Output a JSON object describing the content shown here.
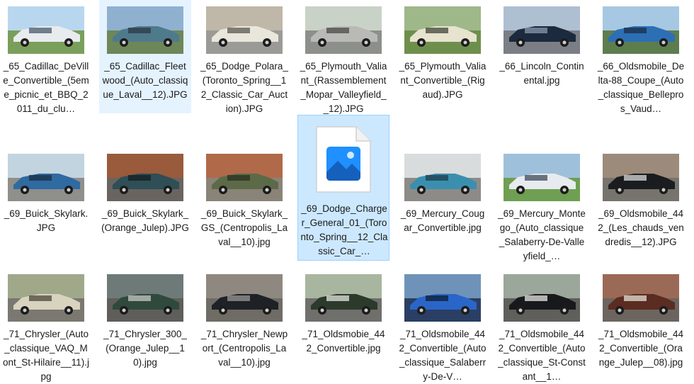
{
  "files": [
    {
      "name": "_65_Cadillac_DeVille_Convertible_(5eme_picnic_et_BBQ_2011_du_clu…",
      "icon": "photo-thumbnail",
      "state": "",
      "colors": {
        "sky": "#b9d6ef",
        "ground": "#7a9f5a",
        "body": "#e8ecef",
        "accent": "#4a5a6a"
      }
    },
    {
      "name": "_65_Cadillac_Fleetwood_(Auto_classique_Laval__12).JPG",
      "icon": "photo-thumbnail",
      "state": "hl",
      "colors": {
        "sky": "#8fb1cf",
        "ground": "#6d8759",
        "body": "#4f7a8c",
        "accent": "#2a3a44"
      }
    },
    {
      "name": "_65_Dodge_Polara_(Toronto_Spring__12_Classic_Car_Auction).JPG",
      "icon": "photo-thumbnail",
      "state": "",
      "colors": {
        "sky": "#bfb7a7",
        "ground": "#9a9a96",
        "body": "#e9e6dc",
        "accent": "#5a5750"
      }
    },
    {
      "name": "_65_Plymouth_Valiant_(Rassemblement_Mopar_Valleyfield__12).JPG",
      "icon": "photo-thumbnail",
      "state": "",
      "colors": {
        "sky": "#c9d2c7",
        "ground": "#8d8f8a",
        "body": "#b9b9b5",
        "accent": "#4a4a48"
      }
    },
    {
      "name": "_65_Plymouth_Valiant_Convertible_(Rigaud).JPG",
      "icon": "photo-thumbnail",
      "state": "",
      "colors": {
        "sky": "#9eb88a",
        "ground": "#6e8f4c",
        "body": "#e7e3cf",
        "accent": "#3e4635"
      }
    },
    {
      "name": "_66_Lincoln_Continental.jpg",
      "icon": "photo-thumbnail",
      "state": "",
      "colors": {
        "sky": "#aebfd2",
        "ground": "#7b7e85",
        "body": "#1c2a3e",
        "accent": "#8b9ab0"
      }
    },
    {
      "name": "_66_Oldsmobile_Delta-88_Coupe_(Auto_classique_Bellepros_Vaud…",
      "icon": "photo-thumbnail",
      "state": "",
      "colors": {
        "sky": "#a7c8e2",
        "ground": "#5e7d4f",
        "body": "#2c6fb5",
        "accent": "#1b2c44"
      }
    },
    {
      "name": "_69_Buick_Skylark.JPG",
      "icon": "photo-thumbnail",
      "state": "",
      "colors": {
        "sky": "#c2d4df",
        "ground": "#8f8f8c",
        "body": "#2f6aa0",
        "accent": "#1a2f44"
      }
    },
    {
      "name": "_69_Buick_Skylark_(Orange_Julep).JPG",
      "icon": "photo-thumbnail",
      "state": "",
      "colors": {
        "sky": "#9a5a3c",
        "ground": "#6a6460",
        "body": "#2f4e56",
        "accent": "#141e22"
      }
    },
    {
      "name": "_69_Buick_Skylark_GS_(Centropolis_Laval__10).jpg",
      "icon": "photo-thumbnail",
      "state": "",
      "colors": {
        "sky": "#b06a4a",
        "ground": "#8a8378",
        "body": "#5c6a48",
        "accent": "#27301e"
      }
    },
    {
      "name": "_69_Dodge_Charger_General_01_(Toronto_Spring__12_Classic_Car_…",
      "icon": "image-file-icon",
      "state": "sel",
      "colors": {
        "sky": "#5fb2f0",
        "ground": "#2a6fc2",
        "body": "#ffffff",
        "accent": "#d9d9d9"
      }
    },
    {
      "name": "_69_Mercury_Cougar_Convertible.jpg",
      "icon": "photo-thumbnail",
      "state": "",
      "colors": {
        "sky": "#d9dcdc",
        "ground": "#8d8b88",
        "body": "#3b8fae",
        "accent": "#1e3d4c"
      }
    },
    {
      "name": "_69_Mercury_Montego_(Auto_classique_Salaberry-De-Valleyfield_…",
      "icon": "photo-thumbnail",
      "state": "",
      "colors": {
        "sky": "#9fc0da",
        "ground": "#6f9f52",
        "body": "#e7ebef",
        "accent": "#3e4a5a"
      }
    },
    {
      "name": "_69_Oldsmobile_442_(Les_chauds_vendredis__12).JPG",
      "icon": "photo-thumbnail",
      "state": "",
      "colors": {
        "sky": "#9c8a7a",
        "ground": "#77746e",
        "body": "#1a1c1f",
        "accent": "#d9d9d9"
      }
    },
    {
      "name": "_71_Chrysler_(Auto_classique_VAQ_Mont_St-Hilaire__11).jpg",
      "icon": "photo-thumbnail",
      "state": "",
      "colors": {
        "sky": "#9fa98a",
        "ground": "#7a7870",
        "body": "#d8d3bf",
        "accent": "#4a463a"
      }
    },
    {
      "name": "_71_Chrysler_300_(Orange_Julep__10).jpg",
      "icon": "photo-thumbnail",
      "state": "",
      "colors": {
        "sky": "#6e7a78",
        "ground": "#5f5e5a",
        "body": "#2f4a3c",
        "accent": "#c9c9c4"
      }
    },
    {
      "name": "_71_Chrysler_Newport_(Centropolis_Laval__10).jpg",
      "icon": "photo-thumbnail",
      "state": "",
      "colors": {
        "sky": "#8e8880",
        "ground": "#6f6c66",
        "body": "#1e2226",
        "accent": "#9a9a96"
      }
    },
    {
      "name": "_71_Oldsmobie_442_Convertible.jpg",
      "icon": "photo-thumbnail",
      "state": "",
      "colors": {
        "sky": "#a8b6a0",
        "ground": "#6f6f6c",
        "body": "#2c3a2c",
        "accent": "#e6e6e0"
      }
    },
    {
      "name": "_71_Oldsmobile_442_Convertible_(Auto_classique_Salaberry-De-V…",
      "icon": "photo-thumbnail",
      "state": "",
      "colors": {
        "sky": "#6f93b8",
        "ground": "#2a3f63",
        "body": "#2a66c9",
        "accent": "#0f1d33"
      }
    },
    {
      "name": "_71_Oldsmobile_442_Convertible_(Auto_classique_St-Constant__1…",
      "icon": "photo-thumbnail",
      "state": "",
      "colors": {
        "sky": "#9aa79a",
        "ground": "#5f5f5c",
        "body": "#18191c",
        "accent": "#e7e7e2"
      }
    },
    {
      "name": "_71_Oldsmobile_442_Convertible_(Orange_Julep__08).jpg",
      "icon": "photo-thumbnail",
      "state": "",
      "colors": {
        "sky": "#9b6a56",
        "ground": "#6c655f",
        "body": "#5a2c22",
        "accent": "#e7e1d8"
      }
    }
  ]
}
